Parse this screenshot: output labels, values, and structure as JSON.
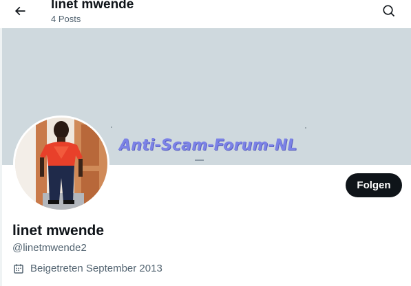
{
  "header": {
    "title": "linet mwende",
    "posts_count": "4 Posts",
    "back_icon": "arrow-left-icon",
    "search_icon": "search-icon"
  },
  "banner": {
    "watermark": "Anti-Scam-Forum-NL",
    "background_color": "#cfd9de",
    "watermark_color": "#7b82e6"
  },
  "profile": {
    "name": "linet mwende",
    "handle": "@linetmwende2",
    "joined": "Beigetreten September 2013",
    "joined_icon": "calendar-icon",
    "follow_label": "Folgen"
  },
  "colors": {
    "text_primary": "#0f1419",
    "text_secondary": "#536471",
    "button_bg": "#0f1419"
  }
}
